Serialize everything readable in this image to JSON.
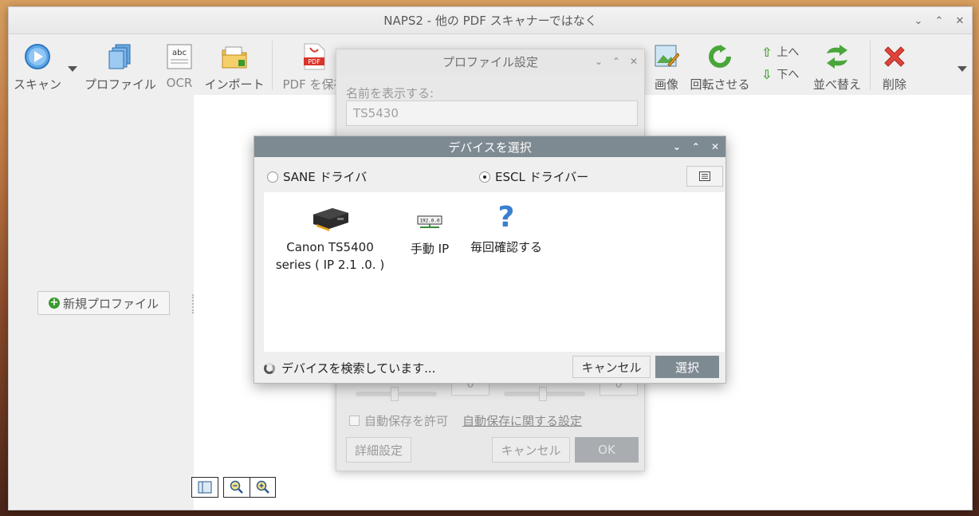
{
  "window": {
    "title": "NAPS2 - 他の PDF スキャナーではなく",
    "controls": [
      "⌄",
      "⌃",
      "✕"
    ]
  },
  "toolbar": {
    "scan": "スキャン",
    "profiles": "プロファイル",
    "ocr": "OCR",
    "import": "インポート",
    "save_pdf": "PDF を保存",
    "image": "画像",
    "rotate": "回転させる",
    "move_up": "上へ",
    "move_down": "下へ",
    "reorder": "並べ替え",
    "delete": "削除",
    "ocr_icon_text": "abc",
    "pdf_icon_text": "PDF"
  },
  "left_pane": {
    "new_profile": "新規プロファイル"
  },
  "profile_dialog": {
    "title": "プロファイル設定",
    "controls": [
      "⌄",
      "⌃",
      "✕"
    ],
    "name_label": "名前を表示する:",
    "name_value": "TS5430",
    "spin_left": "0",
    "spin_right": "0",
    "autosave_label": "自動保存を許可",
    "autosave_link": "自動保存に関する設定",
    "advanced_button": "詳細設定",
    "cancel_button": "キャンセル",
    "ok_button": "OK"
  },
  "device_dialog": {
    "title": "デバイスを選択",
    "controls": [
      "⌄",
      "⌃",
      "✕"
    ],
    "driver_sane": "SANE ドライバ",
    "driver_escl": "ESCL ドライバー",
    "selected_driver": "ESCL ドライバー",
    "devices": [
      {
        "line1": "Canon TS5400",
        "line2": "series ( IP 2.1     .0.  )",
        "icon": "printer-icon"
      },
      {
        "line1": "手動 IP",
        "icon": "ip-address-icon",
        "icon_text": "192.0.0"
      },
      {
        "line1": "毎回確認する",
        "icon": "question-icon"
      }
    ],
    "status": "デバイスを検索しています...",
    "cancel_button": "キャンセル",
    "select_button": "選択"
  }
}
